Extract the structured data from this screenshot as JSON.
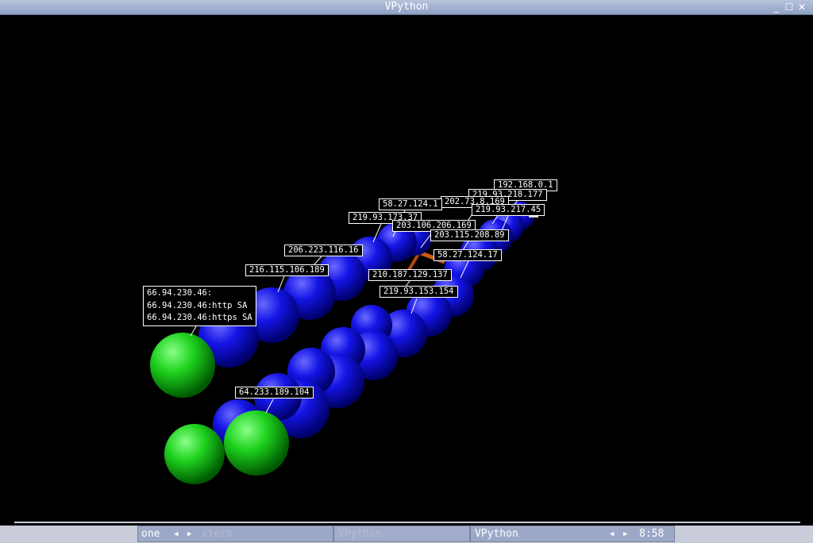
{
  "window": {
    "title": "VPython"
  },
  "labels": {
    "l192": "192.168.0.1",
    "l219_177": "219.93.218.177",
    "l202": "202.73.8.169",
    "l219_45": "219.93.217.45",
    "l58_1": "58.27.124.1",
    "l219_37": "219.93.173.37",
    "l203_169": "203.106.206.169",
    "l203_89": "203.115.208.89",
    "l206": "206.223.116.16",
    "l58_17": "58.27.124.17",
    "l216": "216.115.106.189",
    "l210": "210.187.129.137",
    "l219_154": "219.93.153.154",
    "l64": "64.233.189.104",
    "multi": [
      "66.94.230.46:",
      "66.94.230.46:http SA",
      "66.94.230.46:https SA"
    ]
  },
  "taskbar": {
    "workspace": "one",
    "task_xterm": "xterm",
    "task_vpython_inactive": "VPython",
    "task_vpython_active": "VPython",
    "clock": "8:58"
  },
  "colors": {
    "node": "#1010e0",
    "endpoint": "#20d020",
    "titlebar": "#9aaad0"
  }
}
